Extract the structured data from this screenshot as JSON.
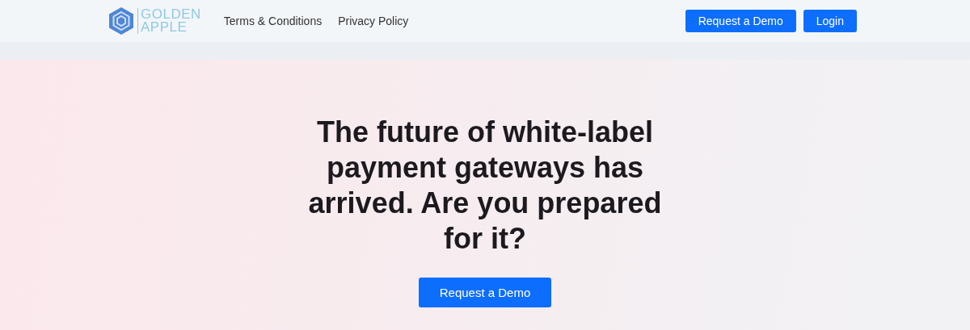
{
  "logo": {
    "line_1": "GOLDEN",
    "line_2": "APPLE"
  },
  "nav": [
    "Terms & Conditions",
    "Privacy Policy"
  ],
  "header_buttons": [
    "Request a Demo",
    "Login"
  ],
  "hero": {
    "headline": "The future of white-label payment gateways has arrived. Are you prepared for it?",
    "button": "Request a Demo"
  }
}
